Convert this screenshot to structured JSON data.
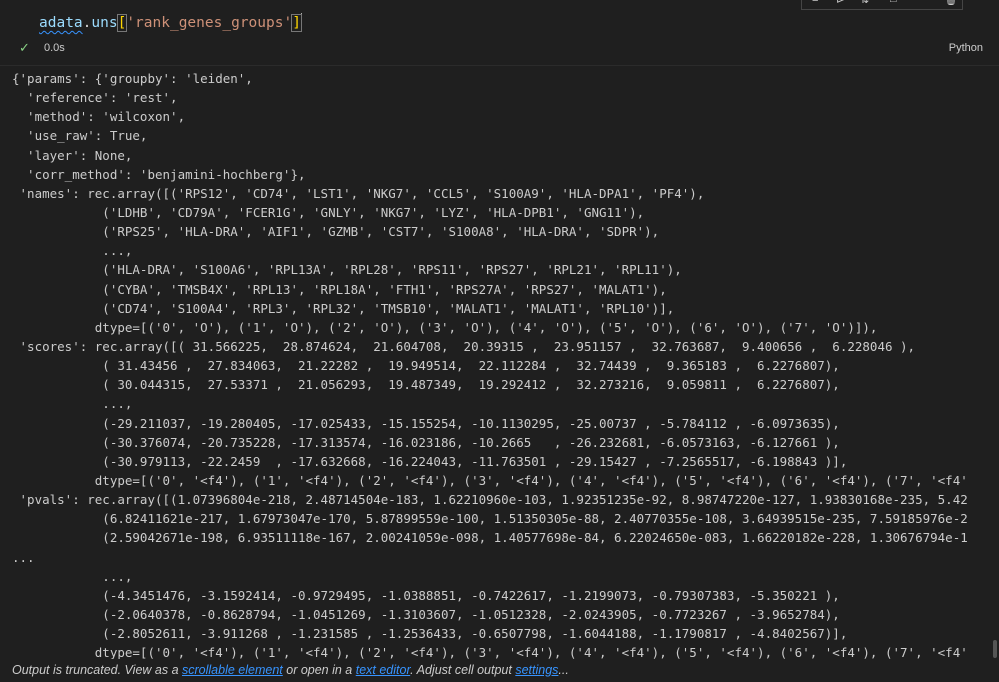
{
  "cell": {
    "code": {
      "var": "adata",
      "dot": ".",
      "attr": "uns",
      "open": "[",
      "key": "'rank_genes_groups'",
      "close": "]"
    },
    "exec_time": "0.0s",
    "language": "Python",
    "status_icon": "check-icon",
    "toolbar_icons": [
      "run-above-icon",
      "run-below-icon",
      "split-icon",
      "more-icon",
      "delete-icon"
    ]
  },
  "output": {
    "lines": [
      "{'params': {'groupby': 'leiden',",
      "  'reference': 'rest',",
      "  'method': 'wilcoxon',",
      "  'use_raw': True,",
      "  'layer': None,",
      "  'corr_method': 'benjamini-hochberg'},",
      " 'names': rec.array([('RPS12', 'CD74', 'LST1', 'NKG7', 'CCL5', 'S100A9', 'HLA-DPA1', 'PF4'),",
      "            ('LDHB', 'CD79A', 'FCER1G', 'GNLY', 'NKG7', 'LYZ', 'HLA-DPB1', 'GNG11'),",
      "            ('RPS25', 'HLA-DRA', 'AIF1', 'GZMB', 'CST7', 'S100A8', 'HLA-DRA', 'SDPR'),",
      "            ...,",
      "            ('HLA-DRA', 'S100A6', 'RPL13A', 'RPL28', 'RPS11', 'RPS27', 'RPL21', 'RPL11'),",
      "            ('CYBA', 'TMSB4X', 'RPL13', 'RPL18A', 'FTH1', 'RPS27A', 'RPS27', 'MALAT1'),",
      "            ('CD74', 'S100A4', 'RPL3', 'RPL32', 'TMSB10', 'MALAT1', 'MALAT1', 'RPL10')],",
      "           dtype=[('0', 'O'), ('1', 'O'), ('2', 'O'), ('3', 'O'), ('4', 'O'), ('5', 'O'), ('6', 'O'), ('7', 'O')]),",
      " 'scores': rec.array([( 31.566225,  28.874624,  21.604708,  20.39315 ,  23.951157 ,  32.763687,  9.400656 ,  6.228046 ),",
      "            ( 31.43456 ,  27.834063,  21.22282 ,  19.949514,  22.112284 ,  32.74439 ,  9.365183 ,  6.2276807),",
      "            ( 30.044315,  27.53371 ,  21.056293,  19.487349,  19.292412 ,  32.273216,  9.059811 ,  6.2276807),",
      "            ...,",
      "            (-29.211037, -19.280405, -17.025433, -15.155254, -10.1130295, -25.00737 , -5.784112 , -6.0973635),",
      "            (-30.376074, -20.735228, -17.313574, -16.023186, -10.2665   , -26.232681, -6.0573163, -6.127661 ),",
      "            (-30.979113, -22.2459  , -17.632668, -16.224043, -11.763501 , -29.15427 , -7.2565517, -6.198843 )],",
      "           dtype=[('0', '<f4'), ('1', '<f4'), ('2', '<f4'), ('3', '<f4'), ('4', '<f4'), ('5', '<f4'), ('6', '<f4'), ('7', '<f4'",
      " 'pvals': rec.array([(1.07396804e-218, 2.48714504e-183, 1.62210960e-103, 1.92351235e-92, 8.98747220e-127, 1.93830168e-235, 5.42",
      "            (6.82411621e-217, 1.67973047e-170, 5.87899559e-100, 1.51350305e-88, 2.40770355e-108, 3.64939515e-235, 7.59185976e-2",
      "            (2.59042671e-198, 6.93511118e-167, 2.00241059e-098, 1.40577698e-84, 6.22024650e-083, 1.66220182e-228, 1.30676794e-1",
      "...",
      "            ...,",
      "            (-4.3451476, -3.1592414, -0.9729495, -1.0388851, -0.7422617, -1.2199073, -0.79307383, -5.350221 ),",
      "            (-2.0640378, -0.8628794, -1.0451269, -1.3103607, -1.0512328, -2.0243905, -0.7723267 , -3.9652784),",
      "            (-2.8052611, -3.911268 , -1.231585 , -1.2536433, -0.6507798, -1.6044188, -1.1790817 , -4.8402567)],",
      "           dtype=[('0', '<f4'), ('1', '<f4'), ('2', '<f4'), ('3', '<f4'), ('4', '<f4'), ('5', '<f4'), ('6', '<f4'), ('7', '<f4'"
    ]
  },
  "footer": {
    "prefix": "Output is truncated. View as a ",
    "link1": "scrollable element",
    "mid1": " or open in a ",
    "link2": "text editor",
    "mid2": ". Adjust cell output ",
    "link3": "settings",
    "suffix": "..."
  },
  "colors": {
    "background": "#1f1f1f",
    "link": "#3794ff",
    "string": "#ce9178",
    "variable": "#9cdcfe",
    "success": "#89d185"
  }
}
